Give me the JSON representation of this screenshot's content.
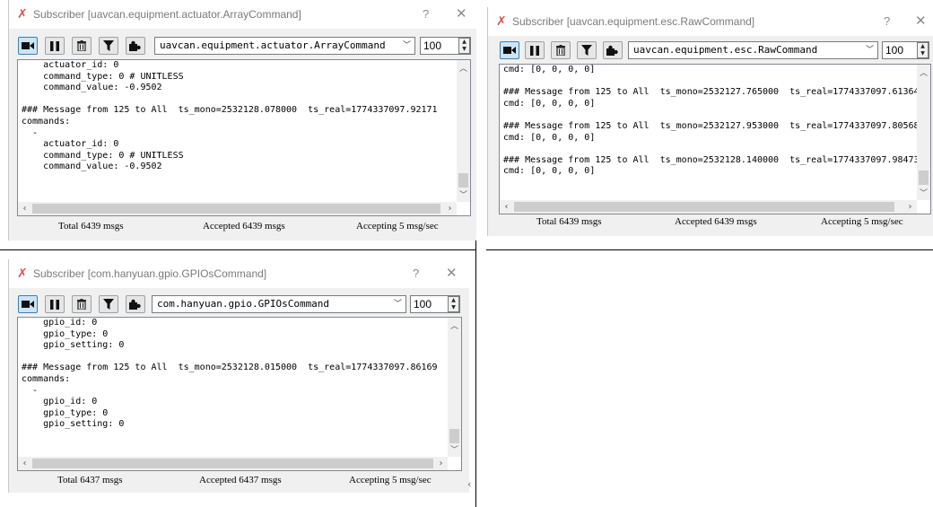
{
  "windows": [
    {
      "title": "Subscriber [uavcan.equipment.actuator.ArrayCommand]",
      "help": "?",
      "close": "✕",
      "data_type": "uavcan.equipment.actuator.ArrayCommand",
      "count": "100",
      "log": "    actuator_id: 0\n    command_type: 0 # UNITLESS\n    command_value: -0.9502\n\n### Message from 125 to All  ts_mono=2532128.078000  ts_real=1774337097.92171\ncommands:\n  -\n    actuator_id: 0\n    command_type: 0 # UNITLESS\n    command_value: -0.9502",
      "status": {
        "total": "Total 6439 msgs",
        "accepted": "Accepted 6439 msgs",
        "rate": "Accepting 5 msg/sec"
      }
    },
    {
      "title": "Subscriber [uavcan.equipment.esc.RawCommand]",
      "help": "?",
      "close": "✕",
      "data_type": "uavcan.equipment.esc.RawCommand",
      "count": "100",
      "log": "cmd: [0, 0, 0, 0]\n\n### Message from 125 to All  ts_mono=2532127.765000  ts_real=1774337097.61364\ncmd: [0, 0, 0, 0]\n\n### Message from 125 to All  ts_mono=2532127.953000  ts_real=1774337097.80568\ncmd: [0, 0, 0, 0]\n\n### Message from 125 to All  ts_mono=2532128.140000  ts_real=1774337097.98473\ncmd: [0, 0, 0, 0]",
      "status": {
        "total": "Total 6439 msgs",
        "accepted": "Accepted 6439 msgs",
        "rate": "Accepting 5 msg/sec"
      }
    },
    {
      "title": "Subscriber [com.hanyuan.gpio.GPIOsCommand]",
      "help": "?",
      "close": "✕",
      "data_type": "com.hanyuan.gpio.GPIOsCommand",
      "count": "100",
      "log": "    gpio_id: 0\n    gpio_type: 0\n    gpio_setting: 0\n\n### Message from 125 to All  ts_mono=2532128.015000  ts_real=1774337097.86169\ncommands:\n  -\n    gpio_id: 0\n    gpio_type: 0\n    gpio_setting: 0",
      "status": {
        "total": "Total 6437 msgs",
        "accepted": "Accepted 6437 msgs",
        "rate": "Accepting 5 msg/sec"
      }
    }
  ],
  "icons": {
    "app": "app-x-icon",
    "record": "video-camera-icon",
    "pause": "pause-icon",
    "clear": "trash-icon",
    "filter": "filter-icon",
    "plugin": "puzzle-icon"
  },
  "colors": {
    "app_icon": "#d9534f",
    "active_button": "#cce4f7",
    "window_bg": "#f0f0f0"
  }
}
